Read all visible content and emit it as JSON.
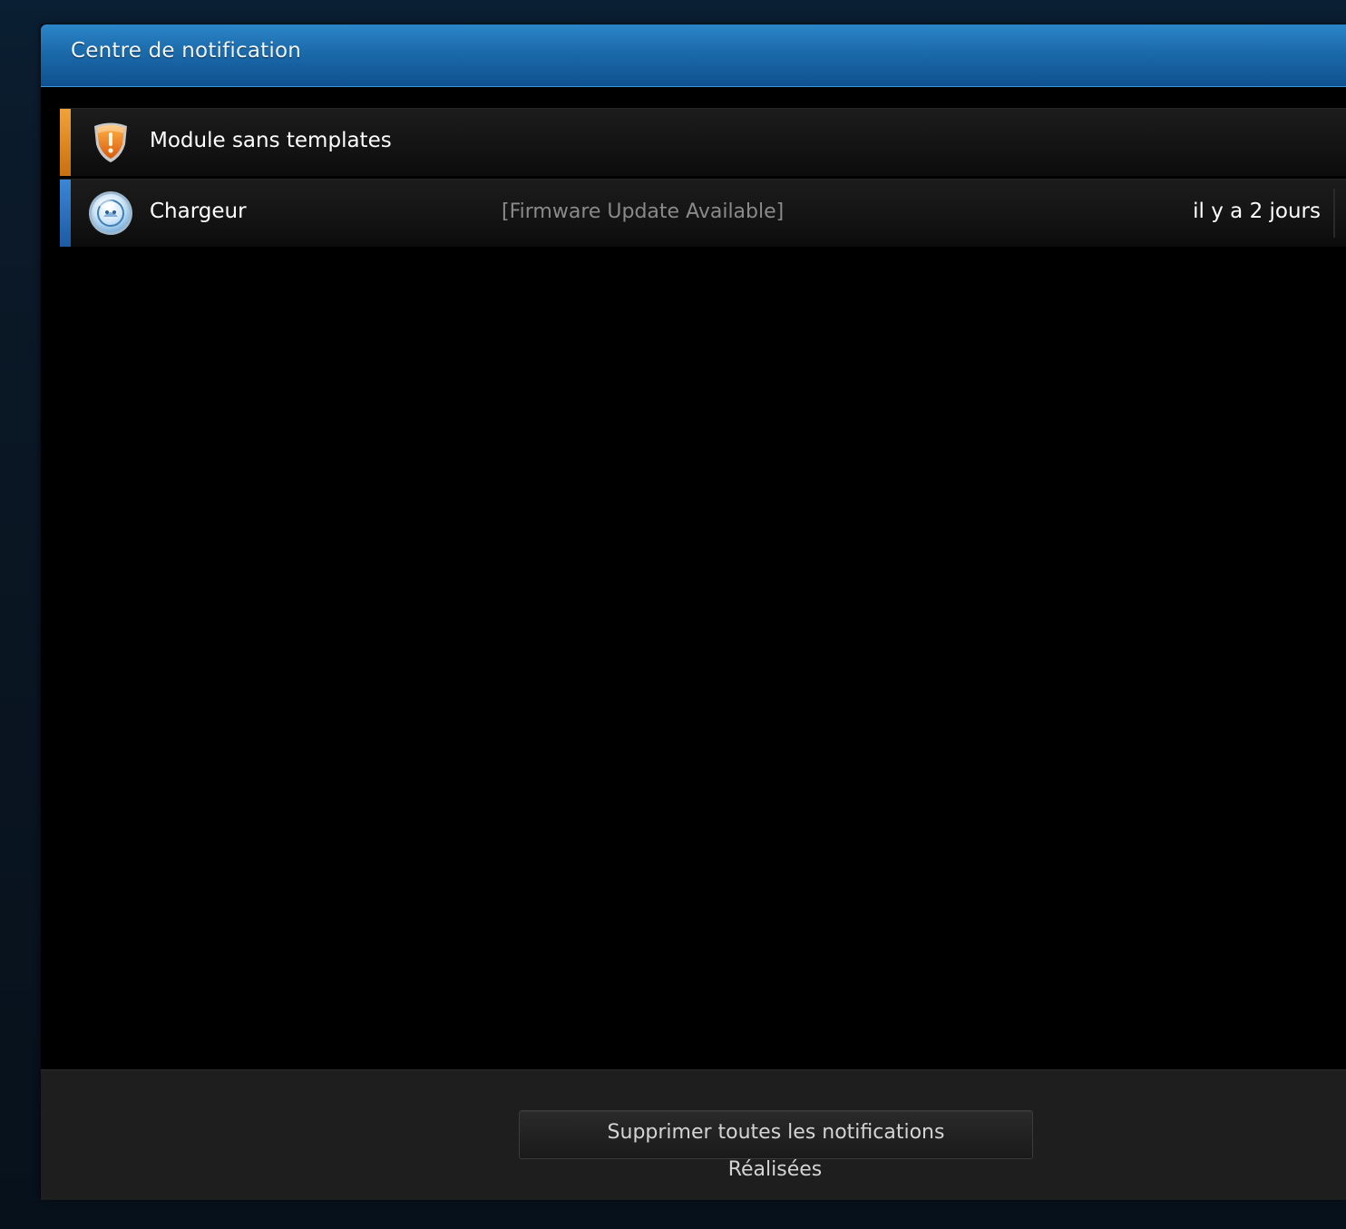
{
  "window": {
    "title": "Centre de notification"
  },
  "notifications": [
    {
      "name": "Module sans templates",
      "message": "",
      "time": "",
      "accent_color": "#e38a1d",
      "icon": "warning-shield-icon"
    },
    {
      "name": "Chargeur",
      "message": "[Firmware Update Available]",
      "time": "il y a 2 jours",
      "accent_color": "#2a6fbf",
      "icon": "charger-module-icon"
    }
  ],
  "footer": {
    "clear_button_line1": "Supprimer toutes les notifications",
    "clear_button_line2": "Réalisées"
  }
}
